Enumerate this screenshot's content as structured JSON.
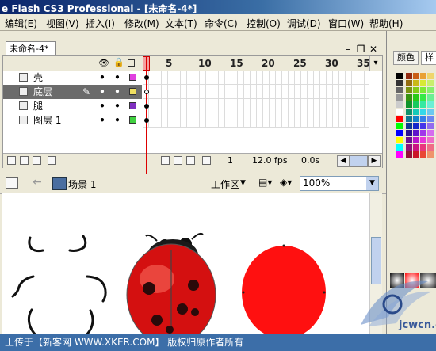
{
  "window": {
    "title": "e Flash CS3 Professional - [未命名-4*]"
  },
  "menu": [
    "编辑(E)",
    "视图(V)",
    "插入(I)",
    "修改(M)",
    "文本(T)",
    "命令(C)",
    "控制(O)",
    "调试(D)",
    "窗口(W)",
    "帮助(H)"
  ],
  "document": {
    "tab_label": "未命名-4*"
  },
  "timeline": {
    "frame_numbers": [
      "1",
      "5",
      "10",
      "15",
      "20",
      "25",
      "30",
      "35"
    ],
    "layers": [
      {
        "name": "壳",
        "color": "#e040e0",
        "selected": false
      },
      {
        "name": "底层",
        "color": "#f0e060",
        "selected": true
      },
      {
        "name": "腿",
        "color": "#8030c0",
        "selected": false
      },
      {
        "name": "图层 1",
        "color": "#40d040",
        "selected": false
      }
    ],
    "current_frame": "1",
    "fps": "12.0 fps",
    "elapsed": "0.0s"
  },
  "editbar": {
    "scene_label": "场景 1",
    "workspace_label": "工作区",
    "zoom": "100%"
  },
  "right_panel": {
    "tabs": [
      "颜色",
      "样"
    ]
  },
  "caption": "上传于【新客网 WWW.XKER.COM】 版权归原作者所有",
  "watermark": {
    "text": "jcwcn.com"
  },
  "colors": {
    "ladybug_red": "#d41010",
    "circle_red": "#ff1010",
    "selected_layer": "#6b6b6b",
    "caption_bar": "#3c6ea8"
  }
}
